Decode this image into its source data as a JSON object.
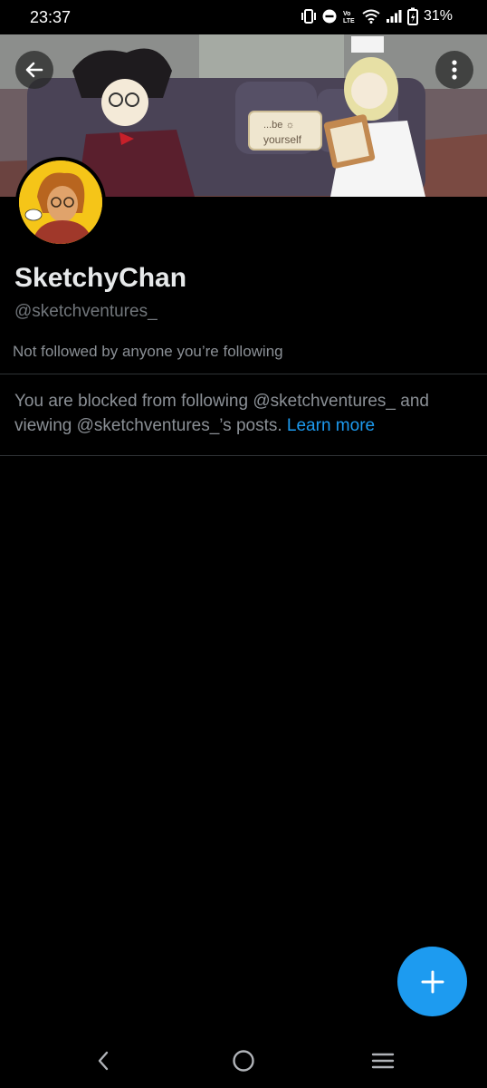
{
  "status_bar": {
    "time": "23:37",
    "battery": "31%",
    "icons": [
      "vibrate-icon",
      "do-not-disturb-icon",
      "volte-icon",
      "wifi-icon",
      "signal-icon",
      "battery-icon"
    ]
  },
  "banner": {
    "sign_text_line1": "...be ☼",
    "sign_text_line2": "yourself"
  },
  "header": {
    "back_icon": "arrow-left-icon",
    "more_icon": "more-vertical-icon"
  },
  "profile": {
    "display_name": "SketchyChan",
    "handle": "@sketchventures_",
    "followers_note": "Not followed by anyone you’re following"
  },
  "blocked_notice": {
    "text": "You are blocked from following @sketchventures_ and viewing @sketchventures_’s posts.",
    "link_label": "Learn more"
  },
  "fab": {
    "icon": "plus-icon"
  },
  "nav": {
    "icons": [
      "nav-back-icon",
      "nav-home-icon",
      "nav-recents-icon"
    ]
  },
  "colors": {
    "accent": "#1d9bf0",
    "background": "#000000",
    "secondary_text": "#71767b"
  }
}
